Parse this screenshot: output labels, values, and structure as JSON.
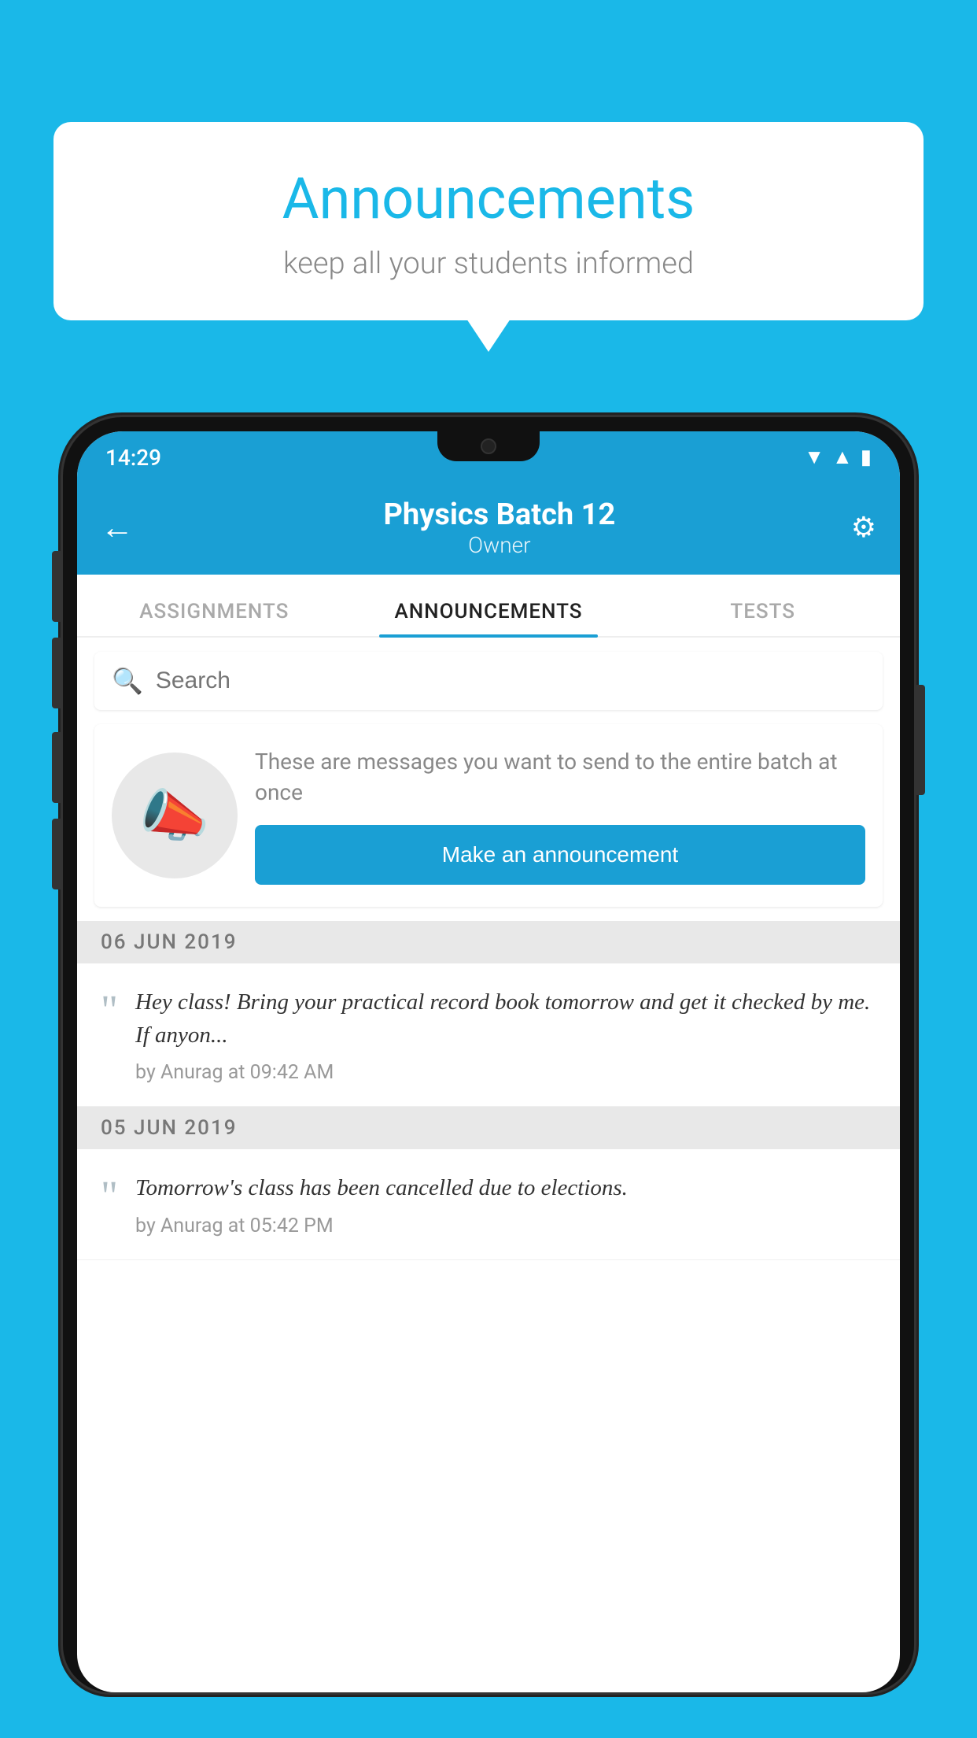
{
  "hero": {
    "title": "Announcements",
    "subtitle": "keep all your students informed"
  },
  "status_bar": {
    "time": "14:29",
    "icons": [
      "wifi",
      "signal",
      "battery"
    ]
  },
  "app_header": {
    "back_label": "←",
    "title": "Physics Batch 12",
    "subtitle": "Owner",
    "settings_label": "⚙"
  },
  "tabs": [
    {
      "label": "ASSIGNMENTS",
      "active": false
    },
    {
      "label": "ANNOUNCEMENTS",
      "active": true
    },
    {
      "label": "TESTS",
      "active": false
    },
    {
      "label": "...",
      "active": false
    }
  ],
  "search": {
    "placeholder": "Search"
  },
  "announcement_prompt": {
    "description": "These are messages you want to send to the entire batch at once",
    "button_label": "Make an announcement"
  },
  "date_groups": [
    {
      "date": "06  JUN  2019",
      "items": [
        {
          "text": "Hey class! Bring your practical record book tomorrow and get it checked by me. If anyon...",
          "meta": "by Anurag at 09:42 AM"
        }
      ]
    },
    {
      "date": "05  JUN  2019",
      "items": [
        {
          "text": "Tomorrow's class has been cancelled due to elections.",
          "meta": "by Anurag at 05:42 PM"
        }
      ]
    }
  ],
  "colors": {
    "background": "#1ab8e8",
    "primary": "#1a9fd4",
    "white": "#ffffff",
    "text_gray": "#888888",
    "title_blue": "#1ab8e8"
  }
}
